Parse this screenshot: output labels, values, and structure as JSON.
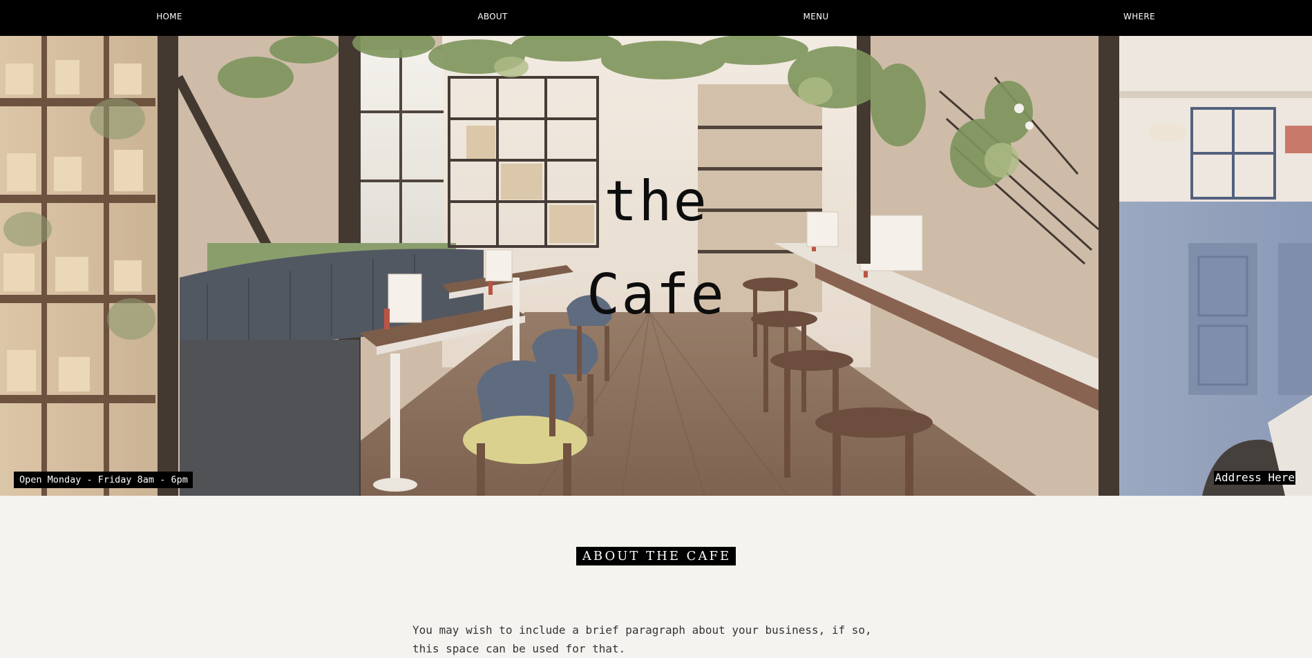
{
  "nav": {
    "items": [
      {
        "label": "HOME"
      },
      {
        "label": "ABOUT"
      },
      {
        "label": "MENU"
      },
      {
        "label": "WHERE"
      }
    ]
  },
  "hero": {
    "title_line1": "the",
    "title_line2": "Cafe",
    "hours": "Open Monday - Friday 8am - 6pm",
    "address": "Address Here"
  },
  "about": {
    "heading": "ABOUT THE CAFE",
    "paragraph": "You may wish to include a brief paragraph about your business, if so, this space can be used for that."
  },
  "colors": {
    "nav_bg": "#000000",
    "nav_text": "#ffffff",
    "page_bg": "#f5f3f0",
    "badge_bg": "#000000"
  }
}
